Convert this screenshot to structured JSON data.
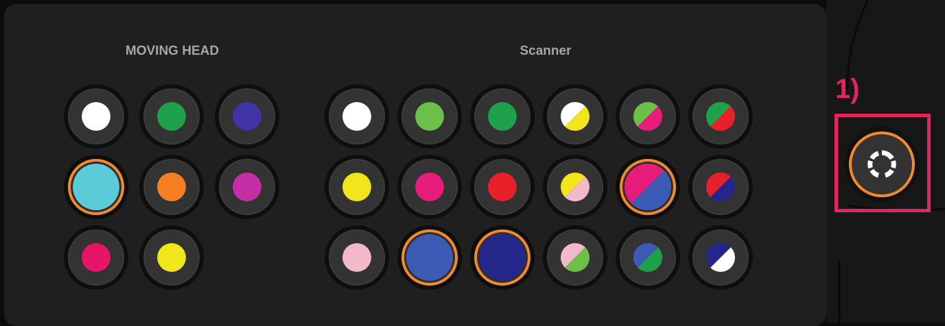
{
  "moving_head": {
    "title": "MOVING HEAD",
    "swatches": [
      {
        "name": "white",
        "colors": [
          "#ffffff"
        ],
        "selected": false
      },
      {
        "name": "green",
        "colors": [
          "#1fa04a"
        ],
        "selected": false
      },
      {
        "name": "indigo",
        "colors": [
          "#3f33a5"
        ],
        "selected": false
      },
      {
        "name": "light-blue",
        "colors": [
          "#5ccbd8"
        ],
        "selected": true
      },
      {
        "name": "orange",
        "colors": [
          "#f57f20"
        ],
        "selected": false
      },
      {
        "name": "magenta",
        "colors": [
          "#c42fa5"
        ],
        "selected": false
      },
      {
        "name": "pink",
        "colors": [
          "#e81566"
        ],
        "selected": false
      },
      {
        "name": "yellow",
        "colors": [
          "#f1e51b"
        ],
        "selected": false
      }
    ]
  },
  "scanner": {
    "title": "Scanner",
    "swatches": [
      {
        "name": "white",
        "colors": [
          "#ffffff"
        ],
        "selected": false
      },
      {
        "name": "lime-green",
        "colors": [
          "#6cc04a"
        ],
        "selected": false
      },
      {
        "name": "green",
        "colors": [
          "#1fa04a"
        ],
        "selected": false
      },
      {
        "name": "white-yellow",
        "colors": [
          "#ffffff",
          "#f1e51b"
        ],
        "selected": false
      },
      {
        "name": "lime-pink",
        "colors": [
          "#6cc04a",
          "#e81c7b"
        ],
        "selected": false
      },
      {
        "name": "green-red",
        "colors": [
          "#1fa04a",
          "#e8202a"
        ],
        "selected": false
      },
      {
        "name": "yellow",
        "colors": [
          "#f1e51b"
        ],
        "selected": false
      },
      {
        "name": "pink",
        "colors": [
          "#e81c7b"
        ],
        "selected": false
      },
      {
        "name": "red",
        "colors": [
          "#e8202a"
        ],
        "selected": false
      },
      {
        "name": "yellow-light-pink",
        "colors": [
          "#f1e51b",
          "#f4b9c8"
        ],
        "selected": false
      },
      {
        "name": "pink-blue",
        "colors": [
          "#e81c7b",
          "#3b5bb5"
        ],
        "selected": true
      },
      {
        "name": "red-navy",
        "colors": [
          "#e8202a",
          "#25268a"
        ],
        "selected": false
      },
      {
        "name": "light-pink",
        "colors": [
          "#f4b9c8"
        ],
        "selected": false
      },
      {
        "name": "blue",
        "colors": [
          "#3b5bb5"
        ],
        "selected": true
      },
      {
        "name": "navy",
        "colors": [
          "#25268a"
        ],
        "selected": true
      },
      {
        "name": "light-pink-lime",
        "colors": [
          "#f4b9c8",
          "#6cc04a"
        ],
        "selected": false
      },
      {
        "name": "blue-green",
        "colors": [
          "#3b5bb5",
          "#1fa04a"
        ],
        "selected": false
      },
      {
        "name": "navy-white",
        "colors": [
          "#25268a",
          "#ffffff"
        ],
        "selected": false
      }
    ]
  },
  "annotation": {
    "label": "1)"
  },
  "colors": {
    "accent": "#f08a2c",
    "annotation": "#e6245c"
  }
}
